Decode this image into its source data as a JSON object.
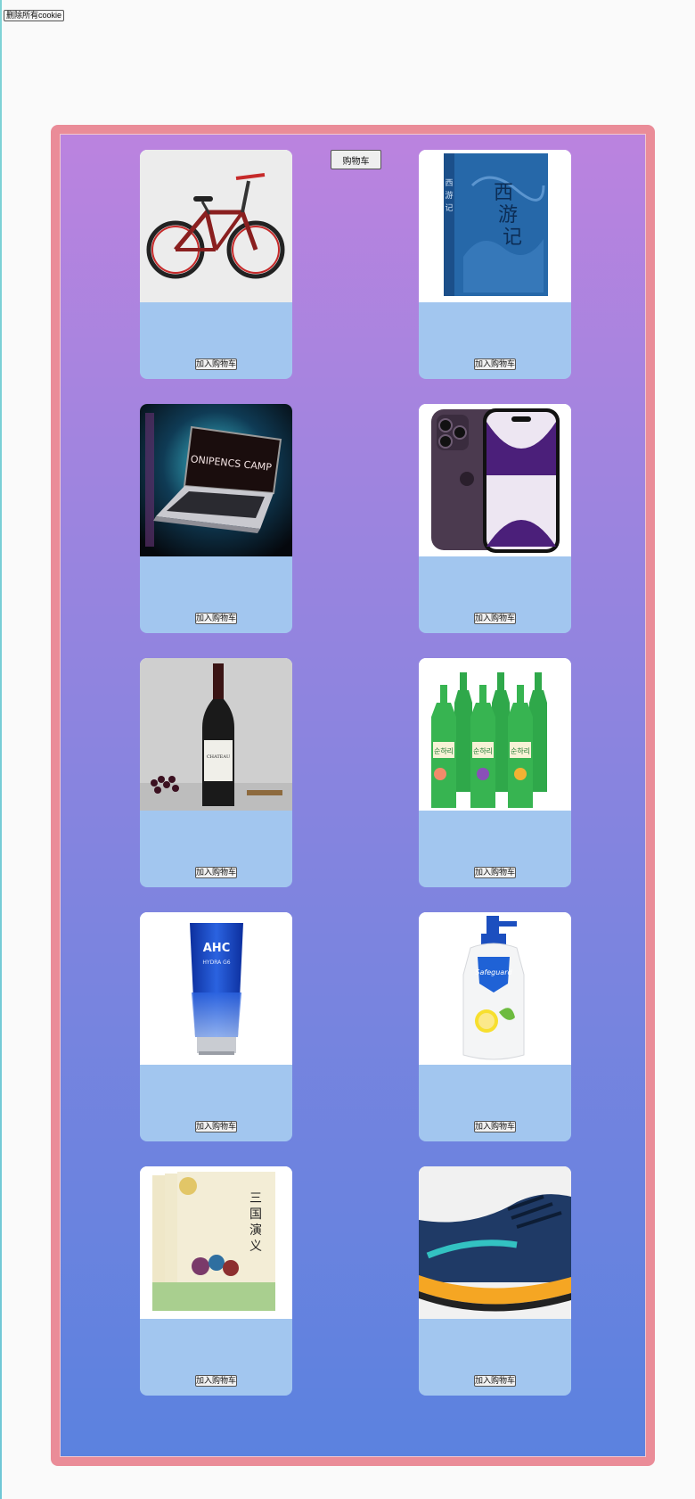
{
  "header": {
    "clear_cookies_label": "删除所有cookie"
  },
  "cart": {
    "label": "购物车"
  },
  "products": [
    {
      "name": "bicycle",
      "add_label": "加入购物车"
    },
    {
      "name": "journey-to-the-west-book",
      "add_label": "加入购物车",
      "cover_title": "西游记"
    },
    {
      "name": "laptop",
      "add_label": "加入购物车",
      "screen_text": "ONIPENCS CAMP"
    },
    {
      "name": "smartphone",
      "add_label": "加入购物车"
    },
    {
      "name": "red-wine",
      "add_label": "加入购物车"
    },
    {
      "name": "soju-bottles",
      "add_label": "加入购物车",
      "label_text": "순하리"
    },
    {
      "name": "ahc-cleanser",
      "add_label": "加入购物车",
      "brand_text": "AHC",
      "sub_text": "HYDRA G6"
    },
    {
      "name": "safeguard-body-wash",
      "add_label": "加入购物车",
      "brand_text": "Safeguard"
    },
    {
      "name": "romance-of-three-kingdoms-book",
      "add_label": "加入购物车",
      "cover_title": "三国演义"
    },
    {
      "name": "running-shoe",
      "add_label": "加入购物车"
    }
  ],
  "colors": {
    "frame": "#ea8c98",
    "panel_top": "#bb83df",
    "panel_bottom": "#5b82df",
    "card": "#a2c6ef"
  }
}
